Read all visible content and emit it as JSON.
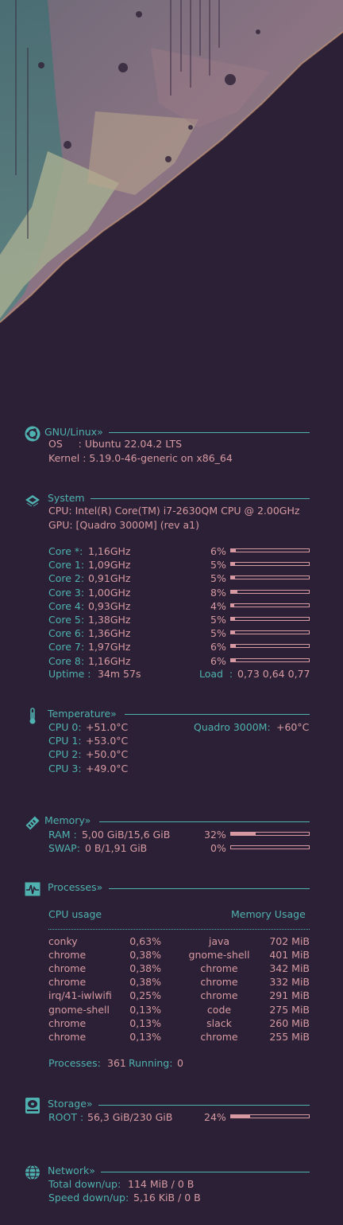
{
  "colors": {
    "accent": "#4fb2b0",
    "value": "#d79aa2",
    "background": "#2b2035"
  },
  "gnu": {
    "icon": "ubuntu-icon",
    "title": "GNU/Linux»",
    "os_label": "OS     : Ubuntu 22.04.2 LTS",
    "kernel_label": "Kernel : 5.19.0-46-generic on x86_64"
  },
  "system": {
    "icon": "cpu-chip-icon",
    "title": "System",
    "cpu": "CPU: Intel(R) Core(TM) i7-2630QM CPU @ 2.00GHz",
    "gpu": "GPU: [Quadro 3000M] (rev a1)",
    "cores": [
      {
        "label": "Core *: ",
        "freq": "1,16GHz",
        "pct_text": "6%",
        "pct": 6
      },
      {
        "label": "Core 1: ",
        "freq": "1,09GHz",
        "pct_text": "5%",
        "pct": 5
      },
      {
        "label": "Core 2: ",
        "freq": "0,91GHz",
        "pct_text": "5%",
        "pct": 5
      },
      {
        "label": "Core 3: ",
        "freq": "1,00GHz",
        "pct_text": "8%",
        "pct": 8
      },
      {
        "label": "Core 4: ",
        "freq": "0,93GHz",
        "pct_text": "4%",
        "pct": 4
      },
      {
        "label": "Core 5: ",
        "freq": "1,38GHz",
        "pct_text": "5%",
        "pct": 5
      },
      {
        "label": "Core 6: ",
        "freq": "1,36GHz",
        "pct_text": "5%",
        "pct": 5
      },
      {
        "label": "Core 7: ",
        "freq": "1,97GHz",
        "pct_text": "6%",
        "pct": 6
      },
      {
        "label": "Core 8: ",
        "freq": "1,16GHz",
        "pct_text": "6%",
        "pct": 6
      }
    ],
    "uptime_label": "Uptime : ",
    "uptime": "34m 57s",
    "load_label": "Load  : ",
    "load": "0,73 0,64 0,77"
  },
  "temperature": {
    "icon": "thermometer-icon",
    "title": "Temperature»",
    "cpu": [
      {
        "label": "CPU 0: ",
        "value": "+51.0°C"
      },
      {
        "label": "CPU 1: ",
        "value": "+53.0°C"
      },
      {
        "label": "CPU 2: ",
        "value": "+50.0°C"
      },
      {
        "label": "CPU 3: ",
        "value": "+49.0°C"
      }
    ],
    "gpu_label": "Quadro 3000M: ",
    "gpu_value": "+60°C"
  },
  "memory": {
    "icon": "ram-icon",
    "title": "Memory»",
    "ram_label": "RAM : ",
    "ram_value": "5,00 GiB/15,6 GiB",
    "ram_pct_text": "32%",
    "ram_pct": 32,
    "swap_label": "SWAP: ",
    "swap_value": "0 B/1,91 GiB",
    "swap_pct_text": "0%",
    "swap_pct": 0
  },
  "processes": {
    "icon": "activity-monitor-icon",
    "title": "Processes»",
    "cpu_header": "CPU usage",
    "mem_header": "Memory Usage",
    "rows": [
      {
        "cpu_name": "conky",
        "cpu_val": "0,63%",
        "mem_name": "java",
        "mem_val": "702 MiB"
      },
      {
        "cpu_name": "chrome",
        "cpu_val": "0,38%",
        "mem_name": "gnome-shell",
        "mem_val": "401 MiB"
      },
      {
        "cpu_name": "chrome",
        "cpu_val": "0,38%",
        "mem_name": "chrome",
        "mem_val": "342 MiB"
      },
      {
        "cpu_name": "chrome",
        "cpu_val": "0,38%",
        "mem_name": "chrome",
        "mem_val": "332 MiB"
      },
      {
        "cpu_name": "irq/41-iwlwifi",
        "cpu_val": "0,25%",
        "mem_name": "chrome",
        "mem_val": "291 MiB"
      },
      {
        "cpu_name": "gnome-shell",
        "cpu_val": "0,13%",
        "mem_name": "code",
        "mem_val": "275 MiB"
      },
      {
        "cpu_name": "chrome",
        "cpu_val": "0,13%",
        "mem_name": "slack",
        "mem_val": "260 MiB"
      },
      {
        "cpu_name": "chrome",
        "cpu_val": "0,13%",
        "mem_name": "chrome",
        "mem_val": "255 MiB"
      }
    ],
    "count_label": "Processes: ",
    "count": "361",
    "running_label": " Running: ",
    "running": "0"
  },
  "storage": {
    "icon": "hard-drive-icon",
    "title": "Storage»",
    "root_label": "ROOT : ",
    "root_value": "56,3 GiB/230 GiB",
    "pct_text": "24%",
    "pct": 24
  },
  "network": {
    "icon": "globe-icon",
    "title": "Network»",
    "total_label": "Total down/up: ",
    "total_value": "114 MiB / 0 B",
    "speed_label": "Speed down/up: ",
    "speed_value": "5,16 KiB / 0 B"
  }
}
